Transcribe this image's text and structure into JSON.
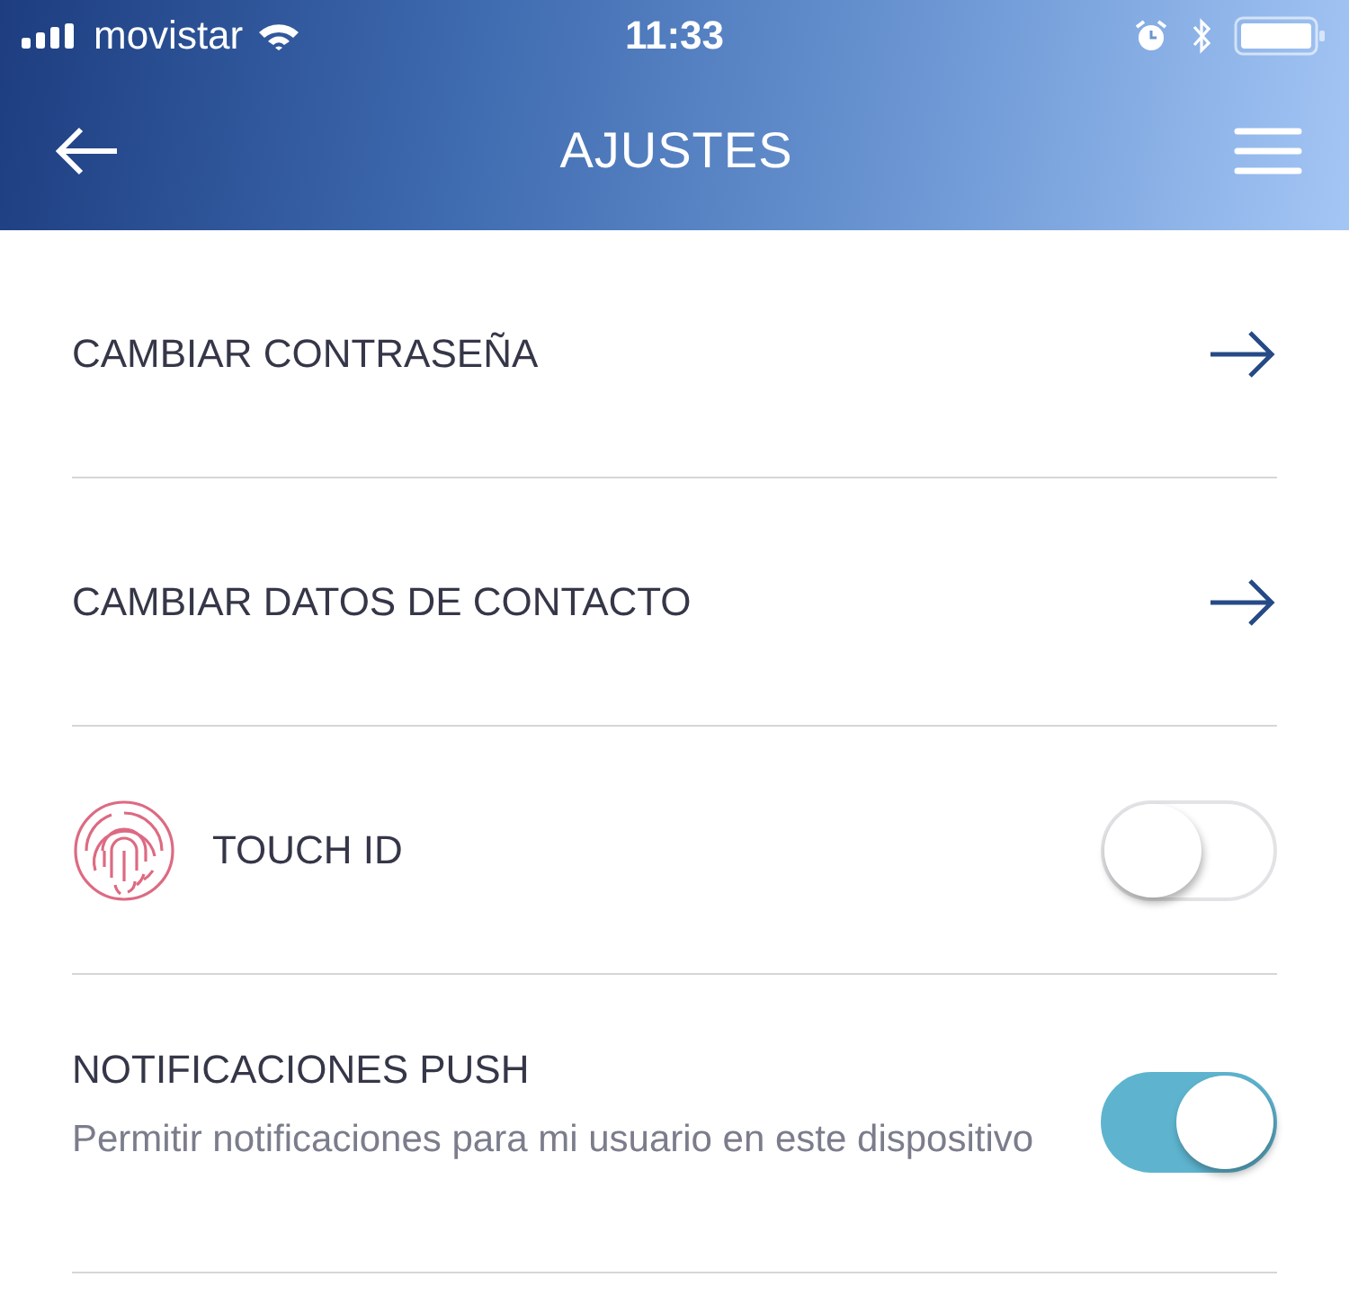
{
  "status_bar": {
    "carrier": "movistar",
    "time": "11:33"
  },
  "header": {
    "title": "AJUSTES"
  },
  "settings": [
    {
      "kind": "link",
      "label": "CAMBIAR CONTRASEÑA"
    },
    {
      "kind": "link",
      "label": "CAMBIAR DATOS DE CONTACTO"
    },
    {
      "kind": "icon_toggle",
      "label": "TOUCH ID",
      "on": false
    },
    {
      "kind": "toggle",
      "label": "NOTIFICACIONES PUSH",
      "description": "Permitir notificaciones para mi usuario en este dispositivo",
      "on": true
    }
  ]
}
